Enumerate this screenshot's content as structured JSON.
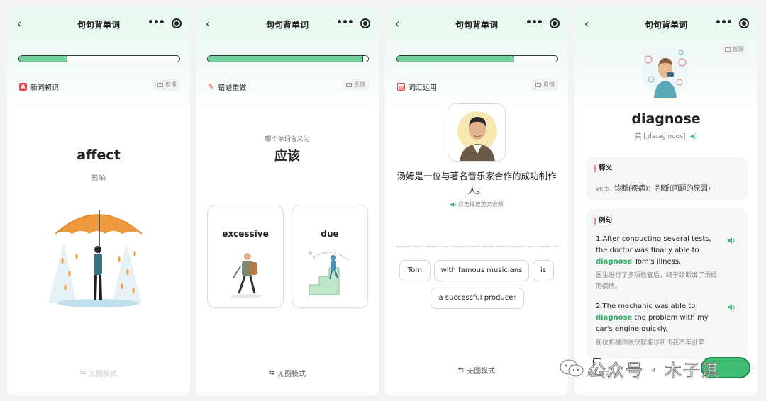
{
  "nav": {
    "title": "句句背单词",
    "more_icon": "more-dots-icon",
    "target_icon": "target-icon"
  },
  "colors": {
    "accent_green": "#6cd29a",
    "highlight_green": "#2fae65",
    "section_red": "#e8494f"
  },
  "feedback_label": "反馈",
  "panels": [
    {
      "progress": 0.3,
      "section_label": "新词初识",
      "word": "affect",
      "meaning": "影响",
      "no_image_mode": "无图模式"
    },
    {
      "progress": 0.97,
      "section_label": "错题重做",
      "question_hint": "哪个单词含义为",
      "question_word": "应该",
      "options": [
        "excessive",
        "due"
      ],
      "no_image_mode": "无图模式"
    },
    {
      "progress": 0.73,
      "section_label": "词汇运用",
      "sentence": "汤姆是一位与著名音乐家合作的成功制作人。",
      "audio_hint": "点击播放英文音频",
      "chips": [
        "Tom",
        "with famous musicians",
        "is",
        "a successful producer"
      ],
      "no_image_mode": "无图模式"
    },
    {
      "word": "diagnose",
      "phonetic": "英 [ˌdaɪəɡˈnoʊs]",
      "definition_title": "释义",
      "definition_pos": "verb.",
      "definition_text": "诊断(疾病)；判断(问题的原因)",
      "examples_title": "例句",
      "example1_pre": "1.After conducting several tests, the doctor was finally able to",
      "example1_hl": "diagnose",
      "example1_post": "Tom's illness.",
      "example1_cn": "医生进行了多项检查后，终于诊断出了汤姆的病情。",
      "example2_pre": "2.The mechanic was able to",
      "example2_hl": "diagnose",
      "example2_post": "the problem with my car's engine quickly.",
      "example2_cn": "那位机械师很快就能诊断出我汽车引擎",
      "bottom_left_label": "加入复习"
    }
  ],
  "watermark": "公众号 · 木子淇"
}
